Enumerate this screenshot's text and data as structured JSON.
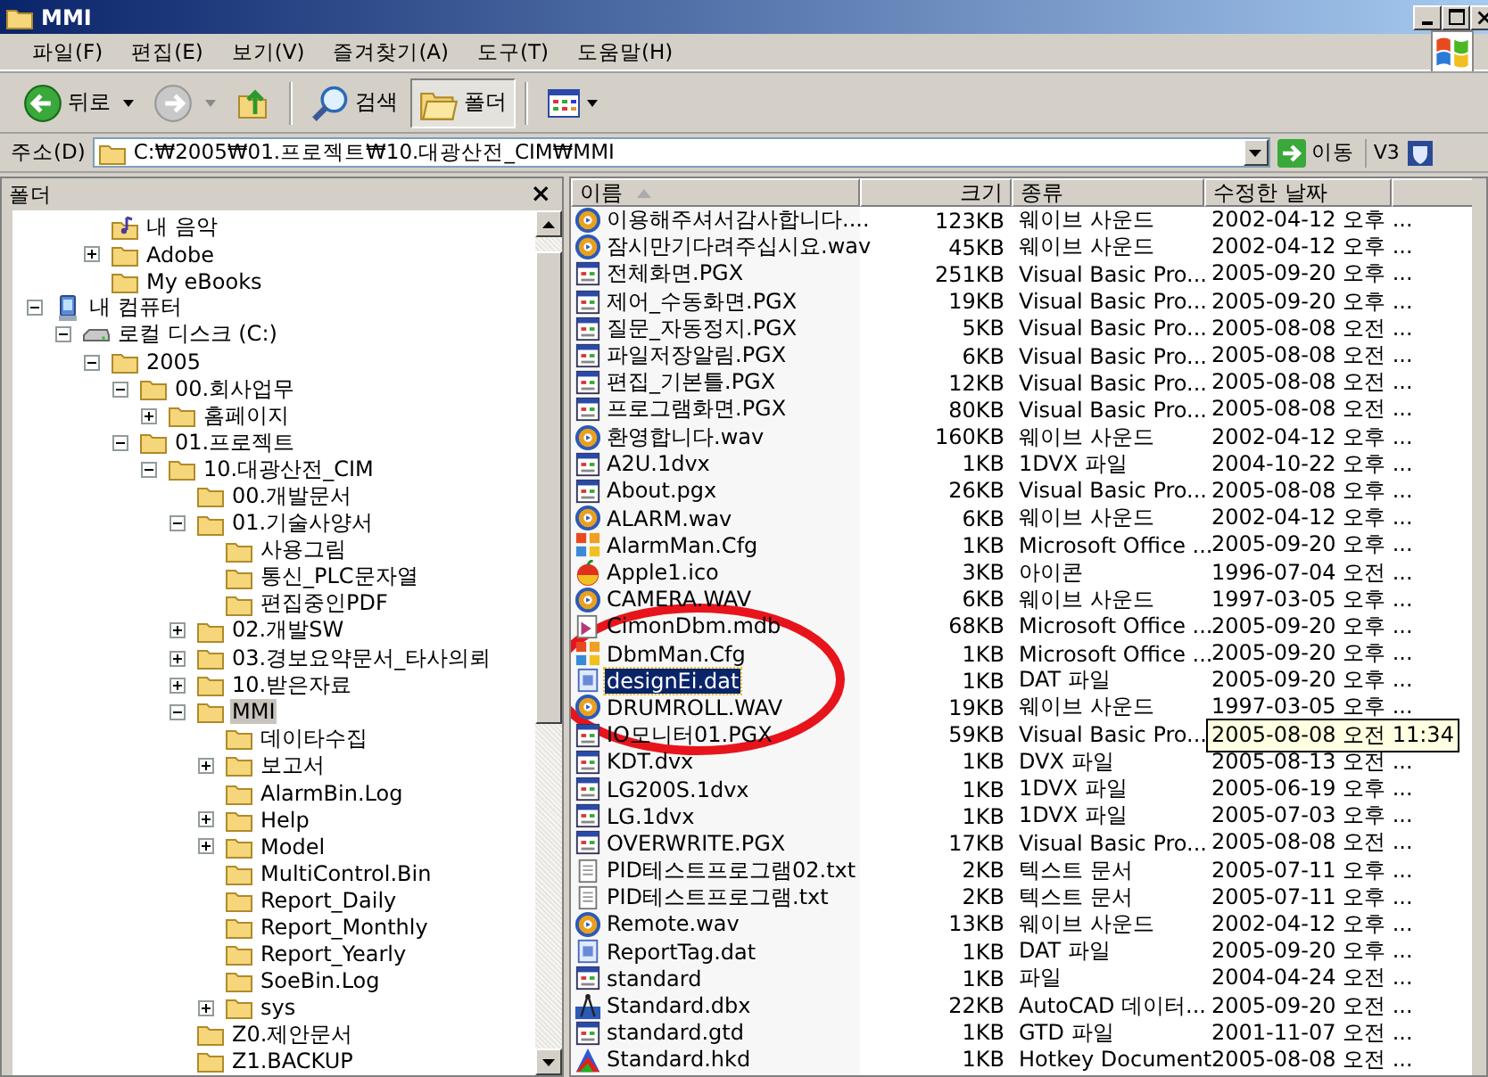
{
  "window": {
    "title": "MMI"
  },
  "menu": [
    "파일(F)",
    "편집(E)",
    "보기(V)",
    "즐겨찾기(A)",
    "도구(T)",
    "도움말(H)"
  ],
  "toolbar": [
    {
      "kind": "back",
      "label": "뒤로",
      "pressed": false
    },
    {
      "kind": "forward",
      "pressed": false
    },
    {
      "kind": "up",
      "pressed": false
    },
    {
      "kind": "search",
      "label": "검색",
      "pressed": false
    },
    {
      "kind": "folders",
      "label": "폴더",
      "pressed": true
    },
    {
      "kind": "views",
      "pressed": false
    }
  ],
  "address": {
    "label": "주소(D)",
    "value": "C:₩2005₩01.프로젝트₩10.대광산전_CIM₩MMI",
    "go_label": "이동",
    "extra": "V3"
  },
  "folder_pane": {
    "title": "폴더",
    "close": "×"
  },
  "tree": [
    {
      "children": [
        {
          "label": "내 음악",
          "kind": "music",
          "selected": false
        },
        {
          "label": "Adobe",
          "kind": "folder",
          "expanded": false,
          "selected": false
        },
        {
          "label": "My eBooks",
          "kind": "folder",
          "selected": false
        }
      ]
    },
    {
      "label": "내 컴퓨터",
      "kind": "computer",
      "expanded": true,
      "selected": false,
      "children": [
        {
          "label": "로컬 디스크 (C:)",
          "kind": "drive",
          "expanded": true,
          "selected": false,
          "children": [
            {
              "label": "2005",
              "kind": "folder",
              "expanded": true,
              "selected": false,
              "children": [
                {
                  "label": "00.회사업무",
                  "kind": "folder",
                  "expanded": true,
                  "selected": false,
                  "children": [
                    {
                      "label": "홈페이지",
                      "kind": "folder",
                      "expanded": false,
                      "selected": false
                    }
                  ]
                },
                {
                  "label": "01.프로젝트",
                  "kind": "folder",
                  "expanded": true,
                  "selected": false,
                  "children": [
                    {
                      "label": "10.대광산전_CIM",
                      "kind": "folder",
                      "expanded": true,
                      "selected": false,
                      "children": [
                        {
                          "label": "00.개발문서",
                          "kind": "folder",
                          "selected": false
                        },
                        {
                          "label": "01.기술사양서",
                          "kind": "folder",
                          "expanded": true,
                          "selected": false,
                          "children": [
                            {
                              "label": "사용그림",
                              "kind": "folder",
                              "selected": false
                            },
                            {
                              "label": "통신_PLC문자열",
                              "kind": "folder",
                              "selected": false
                            },
                            {
                              "label": "편집중인PDF",
                              "kind": "folder",
                              "selected": false
                            }
                          ]
                        },
                        {
                          "label": "02.개발SW",
                          "kind": "folder",
                          "expanded": false,
                          "selected": false
                        },
                        {
                          "label": "03.경보요약문서_타사의뢰",
                          "kind": "folder",
                          "expanded": false,
                          "selected": false
                        },
                        {
                          "label": "10.받은자료",
                          "kind": "folder",
                          "expanded": false,
                          "selected": false
                        },
                        {
                          "label": "MMI",
                          "kind": "folder",
                          "expanded": true,
                          "selected": true,
                          "children": [
                            {
                              "label": "데이타수집",
                              "kind": "folder",
                              "selected": false
                            },
                            {
                              "label": "보고서",
                              "kind": "folder",
                              "expanded": false,
                              "selected": false
                            },
                            {
                              "label": "AlarmBin.Log",
                              "kind": "folder",
                              "selected": false
                            },
                            {
                              "label": "Help",
                              "kind": "folder",
                              "expanded": false,
                              "selected": false
                            },
                            {
                              "label": "Model",
                              "kind": "folder",
                              "expanded": false,
                              "selected": false
                            },
                            {
                              "label": "MultiControl.Bin",
                              "kind": "folder",
                              "selected": false
                            },
                            {
                              "label": "Report_Daily",
                              "kind": "folder",
                              "selected": false
                            },
                            {
                              "label": "Report_Monthly",
                              "kind": "folder",
                              "selected": false
                            },
                            {
                              "label": "Report_Yearly",
                              "kind": "folder",
                              "selected": false
                            },
                            {
                              "label": "SoeBin.Log",
                              "kind": "folder",
                              "selected": false
                            },
                            {
                              "label": "sys",
                              "kind": "folder",
                              "expanded": false,
                              "selected": false
                            }
                          ]
                        },
                        {
                          "label": "Z0.제안문서",
                          "kind": "folder",
                          "selected": false
                        },
                        {
                          "label": "Z1.BACKUP",
                          "kind": "folder",
                          "selected": false
                        }
                      ]
                    }
                  ]
                }
              ]
            }
          ]
        }
      ]
    }
  ],
  "columns": [
    {
      "label": "이름",
      "sorted": true
    },
    {
      "label": "크기",
      "sorted": false
    },
    {
      "label": "종류",
      "sorted": false
    },
    {
      "label": "수정한 날짜",
      "sorted": false
    }
  ],
  "files": [
    {
      "name": "이용해주셔서감사합니다....",
      "size": "123KB",
      "type": "웨이브 사운드",
      "modified": "2002-04-12 오후 ...",
      "kind": "sound",
      "selected": false
    },
    {
      "name": "잠시만기다려주십시요.wav",
      "size": "45KB",
      "type": "웨이브 사운드",
      "modified": "2002-04-12 오후 ...",
      "kind": "sound",
      "selected": false
    },
    {
      "name": "전체화면.PGX",
      "size": "251KB",
      "type": "Visual Basic Pro...",
      "modified": "2005-09-20 오후 ...",
      "kind": "form",
      "selected": false
    },
    {
      "name": "제어_수동화면.PGX",
      "size": "19KB",
      "type": "Visual Basic Pro...",
      "modified": "2005-09-20 오후 ...",
      "kind": "form",
      "selected": false
    },
    {
      "name": "질문_자동정지.PGX",
      "size": "5KB",
      "type": "Visual Basic Pro...",
      "modified": "2005-08-08 오전 ...",
      "kind": "form",
      "selected": false
    },
    {
      "name": "파일저장알림.PGX",
      "size": "6KB",
      "type": "Visual Basic Pro...",
      "modified": "2005-08-08 오전 ...",
      "kind": "form",
      "selected": false
    },
    {
      "name": "편집_기본틀.PGX",
      "size": "12KB",
      "type": "Visual Basic Pro...",
      "modified": "2005-08-08 오전 ...",
      "kind": "form",
      "selected": false
    },
    {
      "name": "프로그램화면.PGX",
      "size": "80KB",
      "type": "Visual Basic Pro...",
      "modified": "2005-08-08 오전 ...",
      "kind": "form",
      "selected": false
    },
    {
      "name": "환영합니다.wav",
      "size": "160KB",
      "type": "웨이브 사운드",
      "modified": "2002-04-12 오후 ...",
      "kind": "sound",
      "selected": false
    },
    {
      "name": "A2U.1dvx",
      "size": "1KB",
      "type": "1DVX 파일",
      "modified": "2004-10-22 오후 ...",
      "kind": "form",
      "selected": false
    },
    {
      "name": "About.pgx",
      "size": "26KB",
      "type": "Visual Basic Pro...",
      "modified": "2005-08-08 오후 ...",
      "kind": "form",
      "selected": false
    },
    {
      "name": "ALARM.wav",
      "size": "6KB",
      "type": "웨이브 사운드",
      "modified": "2002-04-12 오후 ...",
      "kind": "sound",
      "selected": false
    },
    {
      "name": "AlarmMan.Cfg",
      "size": "1KB",
      "type": "Microsoft Office ...",
      "modified": "2005-09-20 오후 ...",
      "kind": "office",
      "selected": false
    },
    {
      "name": "Apple1.ico",
      "size": "3KB",
      "type": "아이콘",
      "modified": "1996-07-04 오전 ...",
      "kind": "apple",
      "selected": false
    },
    {
      "name": "CAMERA.WAV",
      "size": "6KB",
      "type": "웨이브 사운드",
      "modified": "1997-03-05 오후 ...",
      "kind": "sound",
      "selected": false
    },
    {
      "name": "CimonDbm.mdb",
      "size": "68KB",
      "type": "Microsoft Office ...",
      "modified": "2005-09-20 오후 ...",
      "kind": "database",
      "selected": false
    },
    {
      "name": "DbmMan.Cfg",
      "size": "1KB",
      "type": "Microsoft Office ...",
      "modified": "2005-09-20 오후 ...",
      "kind": "office",
      "selected": false
    },
    {
      "name": "designEi.dat",
      "size": "1KB",
      "type": "DAT 파일",
      "modified": "2005-09-20 오후 ...",
      "kind": "data",
      "selected": true
    },
    {
      "name": "DRUMROLL.WAV",
      "size": "19KB",
      "type": "웨이브 사운드",
      "modified": "1997-03-05 오후 ...",
      "kind": "sound",
      "selected": false
    },
    {
      "name": "IO모니터01.PGX",
      "size": "59KB",
      "type": "Visual Basic Pro...",
      "tooltip": "2005-08-08 오전 11:34",
      "kind": "form",
      "selected": false
    },
    {
      "name": "KDT.dvx",
      "size": "1KB",
      "type": "DVX 파일",
      "modified": "2005-08-13 오전 ...",
      "kind": "form",
      "selected": false
    },
    {
      "name": "LG200S.1dvx",
      "size": "1KB",
      "type": "1DVX 파일",
      "modified": "2005-06-19 오후 ...",
      "kind": "form",
      "selected": false
    },
    {
      "name": "LG.1dvx",
      "size": "1KB",
      "type": "1DVX 파일",
      "modified": "2005-07-03 오후 ...",
      "kind": "form",
      "selected": false
    },
    {
      "name": "OVERWRITE.PGX",
      "size": "17KB",
      "type": "Visual Basic Pro...",
      "modified": "2005-08-08 오전 ...",
      "kind": "form",
      "selected": false
    },
    {
      "name": "PID테스트프로그램02.txt",
      "size": "2KB",
      "type": "텍스트 문서",
      "modified": "2005-07-11 오후 ...",
      "kind": "text",
      "selected": false
    },
    {
      "name": "PID테스트프로그램.txt",
      "size": "2KB",
      "type": "텍스트 문서",
      "modified": "2005-07-11 오후 ...",
      "kind": "text",
      "selected": false
    },
    {
      "name": "Remote.wav",
      "size": "13KB",
      "type": "웨이브 사운드",
      "modified": "2002-04-12 오후 ...",
      "kind": "sound",
      "selected": false
    },
    {
      "name": "ReportTag.dat",
      "size": "1KB",
      "type": "DAT 파일",
      "modified": "2005-09-20 오후 ...",
      "kind": "data",
      "selected": false
    },
    {
      "name": "standard",
      "size": "1KB",
      "type": "파일",
      "modified": "2004-04-24 오전 ...",
      "kind": "form",
      "selected": false
    },
    {
      "name": "Standard.dbx",
      "size": "22KB",
      "type": "AutoCAD 데이터...",
      "modified": "2005-09-20 오전 ...",
      "kind": "cad",
      "selected": false
    },
    {
      "name": "standard.gtd",
      "size": "1KB",
      "type": "GTD 파일",
      "modified": "2001-11-07 오전 ...",
      "kind": "form",
      "selected": false
    },
    {
      "name": "Standard.hkd",
      "size": "1KB",
      "type": "Hotkey Document",
      "modified": "2005-08-08 오전 ...",
      "kind": "hotkey",
      "selected": false
    }
  ],
  "annotation": {
    "kind": "ellipse",
    "color": "#e8141c"
  }
}
